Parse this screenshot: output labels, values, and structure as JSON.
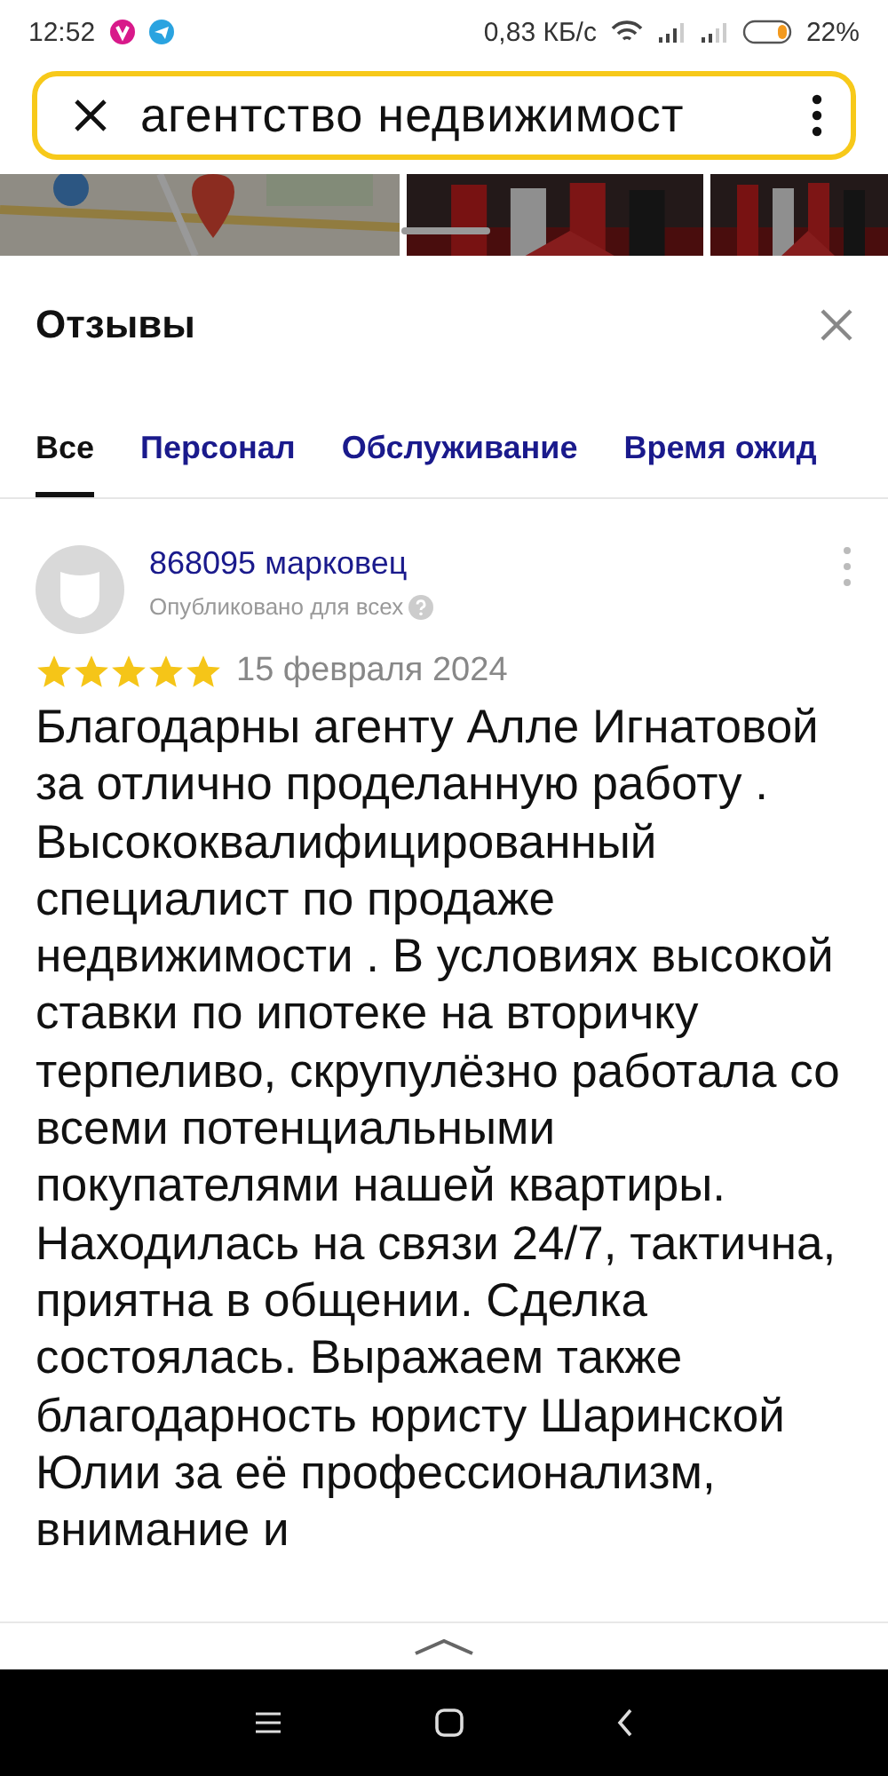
{
  "status_bar": {
    "time": "12:52",
    "speed": "0,83 КБ/с",
    "battery": "22%"
  },
  "search": {
    "value": "агентство недвижимост"
  },
  "photos": [
    {
      "kind": "map"
    },
    {
      "kind": "picture"
    },
    {
      "kind": "picture"
    }
  ],
  "sheet": {
    "title": "Отзывы",
    "tabs": [
      {
        "label": "Все",
        "selected": true
      },
      {
        "label": "Персонал",
        "selected": false
      },
      {
        "label": "Обслуживание",
        "selected": false
      },
      {
        "label": "Время ожид",
        "selected": false
      }
    ],
    "review": {
      "author": "868095 марковец",
      "visibility": "Опубликовано для всех",
      "stars": 5,
      "date": "15 февраля 2024",
      "text": "Благодарны агенту Алле Игнатовой за отлично проделанную работу . Высококвалифицированный специалист по продаже недвижимости . В условиях высокой ставки по ипотеке на вторичку терпеливо, скрупулёзно работала со всеми потенциальными покупателями нашей квартиры. Находилась на связи 24/7, тактична, приятна в общении. Сделка состоялась. Выражаем также благодарность юристу Шаринской Юлии за её профессионализм, внимание и"
    }
  }
}
